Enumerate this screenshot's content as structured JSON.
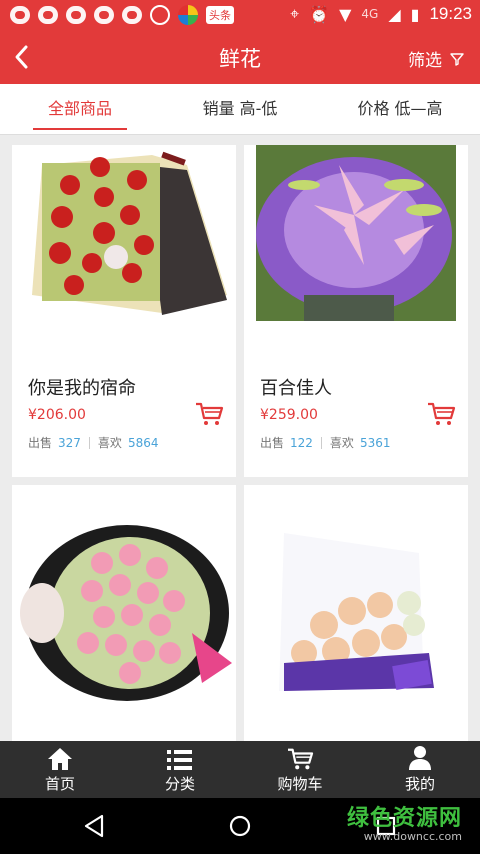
{
  "status_bar": {
    "time": "19:23",
    "network": "4G",
    "news_badge": "头条"
  },
  "header": {
    "title": "鲜花",
    "filter_label": "筛选"
  },
  "tabs": [
    {
      "label": "全部商品",
      "active": true
    },
    {
      "label": "销量 高-低",
      "active": false
    },
    {
      "label": "价格 低—高",
      "active": false
    }
  ],
  "products": [
    {
      "name": "你是我的宿命",
      "price": "¥206.00",
      "sold_label": "出售",
      "sold": "327",
      "likes_label": "喜欢",
      "likes": "5864"
    },
    {
      "name": "百合佳人",
      "price": "¥259.00",
      "sold_label": "出售",
      "sold": "122",
      "likes_label": "喜欢",
      "likes": "5361"
    },
    {
      "name": "",
      "price": "",
      "sold_label": "",
      "sold": "",
      "likes_label": "",
      "likes": ""
    },
    {
      "name": "",
      "price": "",
      "sold_label": "",
      "sold": "",
      "likes_label": "",
      "likes": ""
    }
  ],
  "bottom_nav": [
    {
      "label": "首页",
      "icon": "home-icon"
    },
    {
      "label": "分类",
      "icon": "list-icon"
    },
    {
      "label": "购物车",
      "icon": "cart-icon"
    },
    {
      "label": "我的",
      "icon": "user-icon"
    }
  ],
  "watermark": {
    "main": "绿色资源网",
    "sub": "www.downcc.com"
  },
  "colors": {
    "brand": "#e23a3a",
    "link": "#4aa3d8",
    "nav_bg": "#2f2f2f"
  }
}
